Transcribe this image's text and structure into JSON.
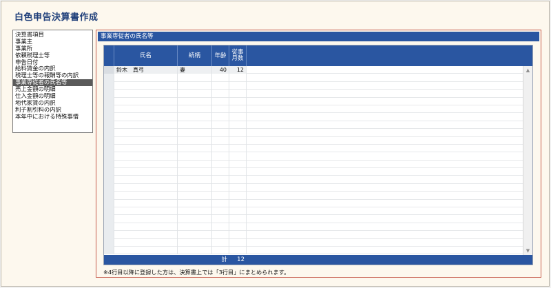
{
  "window": {
    "title": "白色申告決算書作成"
  },
  "sidebar": {
    "items": [
      {
        "label": "決算書項目",
        "selected": false
      },
      {
        "label": "事業主",
        "selected": false
      },
      {
        "label": "事業所",
        "selected": false
      },
      {
        "label": "依頼税理士等",
        "selected": false
      },
      {
        "label": "申告日付",
        "selected": false
      },
      {
        "label": "給料賃金の内訳",
        "selected": false
      },
      {
        "label": "税理士等の報酬等の内訳",
        "selected": false
      },
      {
        "label": "事業専従者の氏名等",
        "selected": true
      },
      {
        "label": "売上金額の明細",
        "selected": false
      },
      {
        "label": "仕入金額の明細",
        "selected": false
      },
      {
        "label": "地代家賃の内訳",
        "selected": false
      },
      {
        "label": "利子割引料の内訳",
        "selected": false
      },
      {
        "label": "本年中における特殊事情",
        "selected": false
      }
    ]
  },
  "panel": {
    "header": "事業専従者の氏名等",
    "columns": {
      "name": "氏名",
      "relation": "続柄",
      "age": "年齢",
      "months": "従事\n月数"
    },
    "rows": [
      {
        "name": "鈴木　真弓",
        "relation": "妻",
        "age": "40",
        "months": "12"
      }
    ],
    "total_label": "計",
    "total_months": "12",
    "note": "※4行目以降に登録した方は、決算書上では「3行目」にまとめられます。"
  },
  "icons": {
    "scroll_up": "triangle-up-icon",
    "scroll_down": "triangle-down-icon"
  },
  "colors": {
    "accent": "#2a56a1",
    "title": "#1f3f7a",
    "panel_border": "#c55a4a",
    "background": "#fdf8ee",
    "selected": "#5a5a5a"
  }
}
